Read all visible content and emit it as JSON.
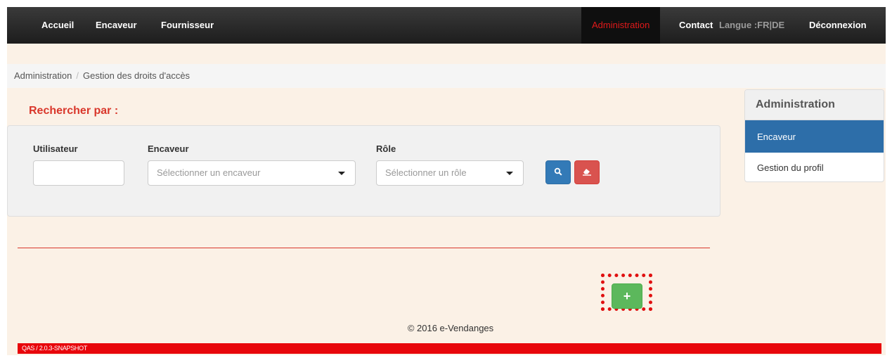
{
  "nav": {
    "items": [
      "Accueil",
      "Encaveur",
      "Fournisseur"
    ],
    "active": "Administration",
    "contact": "Contact",
    "lang_label": "Langue :",
    "lang_fr": "FR",
    "lang_sep": "|",
    "lang_de": "DE",
    "logout": "Déconnexion"
  },
  "breadcrumb": {
    "root": "Administration",
    "separator": "/",
    "current": "Gestion des droits d'accès"
  },
  "search": {
    "title": "Rechercher par :",
    "user_label": "Utilisateur",
    "user_value": "",
    "encaveur_label": "Encaveur",
    "encaveur_placeholder": "Sélectionner un encaveur",
    "role_label": "Rôle",
    "role_placeholder": "Sélectionner un rôle",
    "search_icon": "search-icon",
    "clear_icon": "eraser-icon"
  },
  "add_button": {
    "label": "+"
  },
  "footer": {
    "copyright": "© 2016 e-Vendanges"
  },
  "version": {
    "label": "QAS / 2.0.3-SNAPSHOT"
  },
  "side_panel": {
    "heading": "Administration",
    "items": [
      "Encaveur",
      "Gestion du profil"
    ]
  },
  "colors": {
    "accent_red": "#d9372b",
    "primary_blue": "#337ab7",
    "danger_red": "#d9534f",
    "success_green": "#5cb85c",
    "page_bg": "#fbf1e6"
  }
}
